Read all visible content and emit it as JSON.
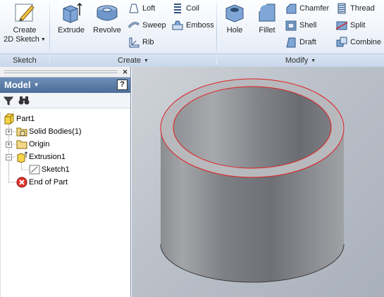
{
  "ribbon": {
    "sketch_group": {
      "label": "Sketch",
      "create_sketch_label": "Create\n2D Sketch",
      "create_sketch_line1": "Create",
      "create_sketch_line2": "2D Sketch"
    },
    "create_group": {
      "label": "Create",
      "extrude": "Extrude",
      "revolve": "Revolve",
      "loft": "Loft",
      "sweep": "Sweep",
      "rib": "Rib",
      "coil": "Coil",
      "emboss": "Emboss"
    },
    "modify_group": {
      "label": "Modify",
      "hole": "Hole",
      "fillet": "Fillet",
      "chamfer": "Chamfer",
      "shell": "Shell",
      "draft": "Draft",
      "thread": "Thread",
      "split": "Split",
      "combine": "Combine"
    }
  },
  "browser": {
    "title": "Model",
    "help": "?",
    "close": "×",
    "tree": [
      {
        "label": "Part1"
      },
      {
        "label": "Solid Bodies(1)"
      },
      {
        "label": "Origin"
      },
      {
        "label": "Extrusion1"
      },
      {
        "label": "Sketch1"
      },
      {
        "label": "End of Part"
      }
    ]
  },
  "icons": {
    "filter": "filter-icon",
    "find": "binoculars-icon"
  },
  "colors": {
    "edge_highlight": "#e02020",
    "panel_title": "#4b6d98"
  }
}
